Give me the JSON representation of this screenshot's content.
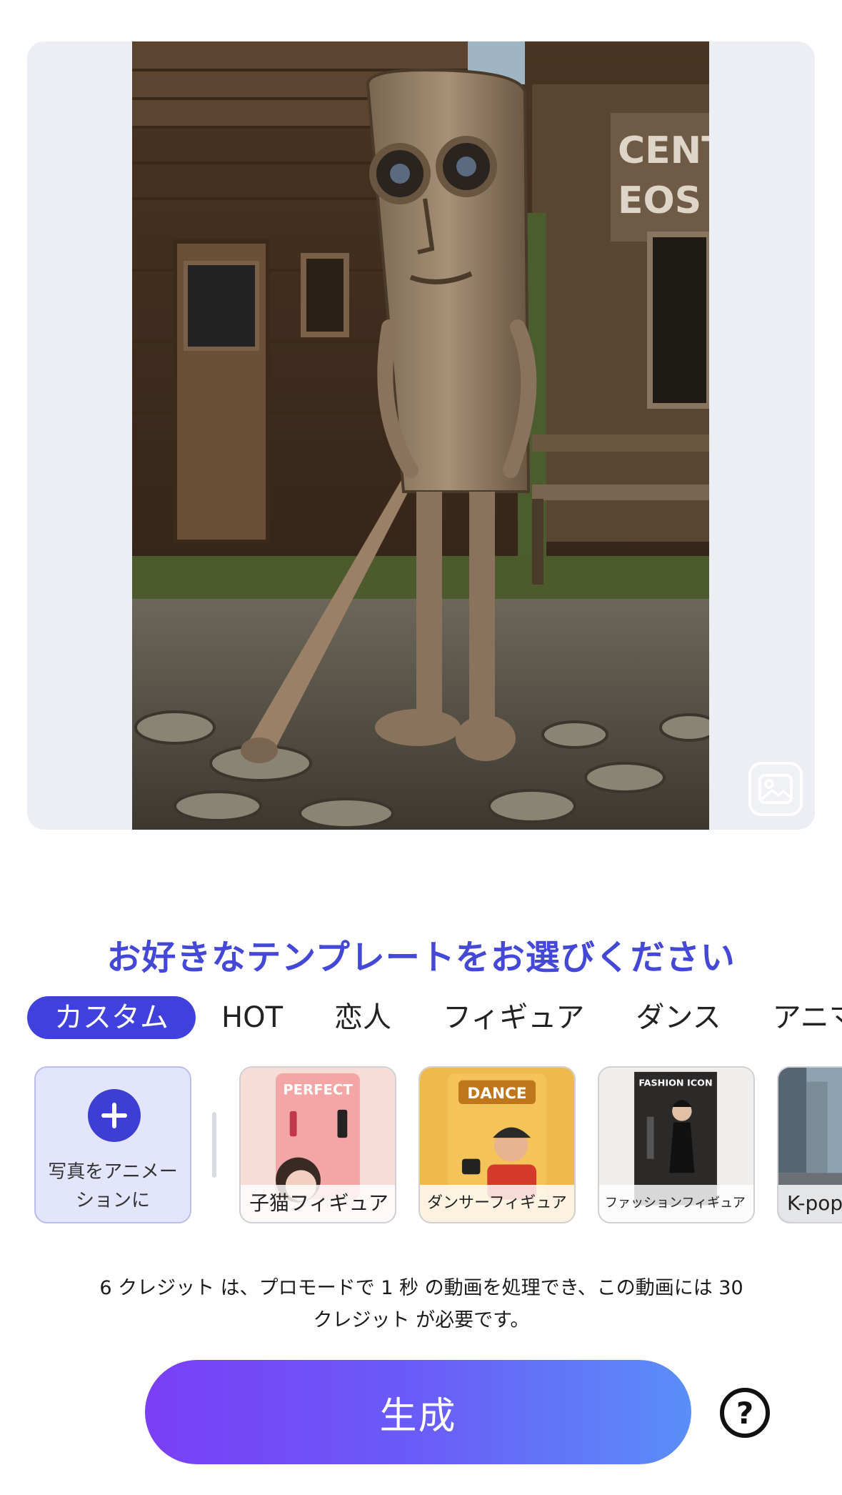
{
  "preview": {
    "photo_description_icon": "image-icon",
    "change_photo_icon": "image-icon"
  },
  "heading": "お好きなテンプレートをお選びください",
  "tabs": [
    {
      "label": "カスタム",
      "active": true
    },
    {
      "label": "HOT",
      "active": false
    },
    {
      "label": "恋人",
      "active": false
    },
    {
      "label": "フィギュア",
      "active": false
    },
    {
      "label": "ダンス",
      "active": false
    },
    {
      "label": "アニマ",
      "active": false
    }
  ],
  "templates": {
    "add": {
      "icon": "plus-icon",
      "label_line1": "写真をアニメー",
      "label_line2": "ションに"
    },
    "items": [
      {
        "caption": "子猫フィギュア",
        "card_text": "PERFECT"
      },
      {
        "caption": "ダンサーフィギュア",
        "card_text": "DANCE"
      },
      {
        "caption": "ファッションフィギュア",
        "card_text": "FASHION ICON"
      },
      {
        "caption": "K-pop"
      }
    ]
  },
  "preview_sign": {
    "line1": "CENTO",
    "line2": "EOS B"
  },
  "credit_note": {
    "line1": "6 クレジット は、プロモードで 1 秒 の動画を処理でき、この動画には 30",
    "line2": "クレジット が必要です。"
  },
  "generate_label": "生成",
  "help_label": "?",
  "colors": {
    "accent": "#4040dc",
    "heading": "#4448d6",
    "generate_gradient_start": "#7a3ef5",
    "generate_gradient_end": "#5a8ef8"
  }
}
